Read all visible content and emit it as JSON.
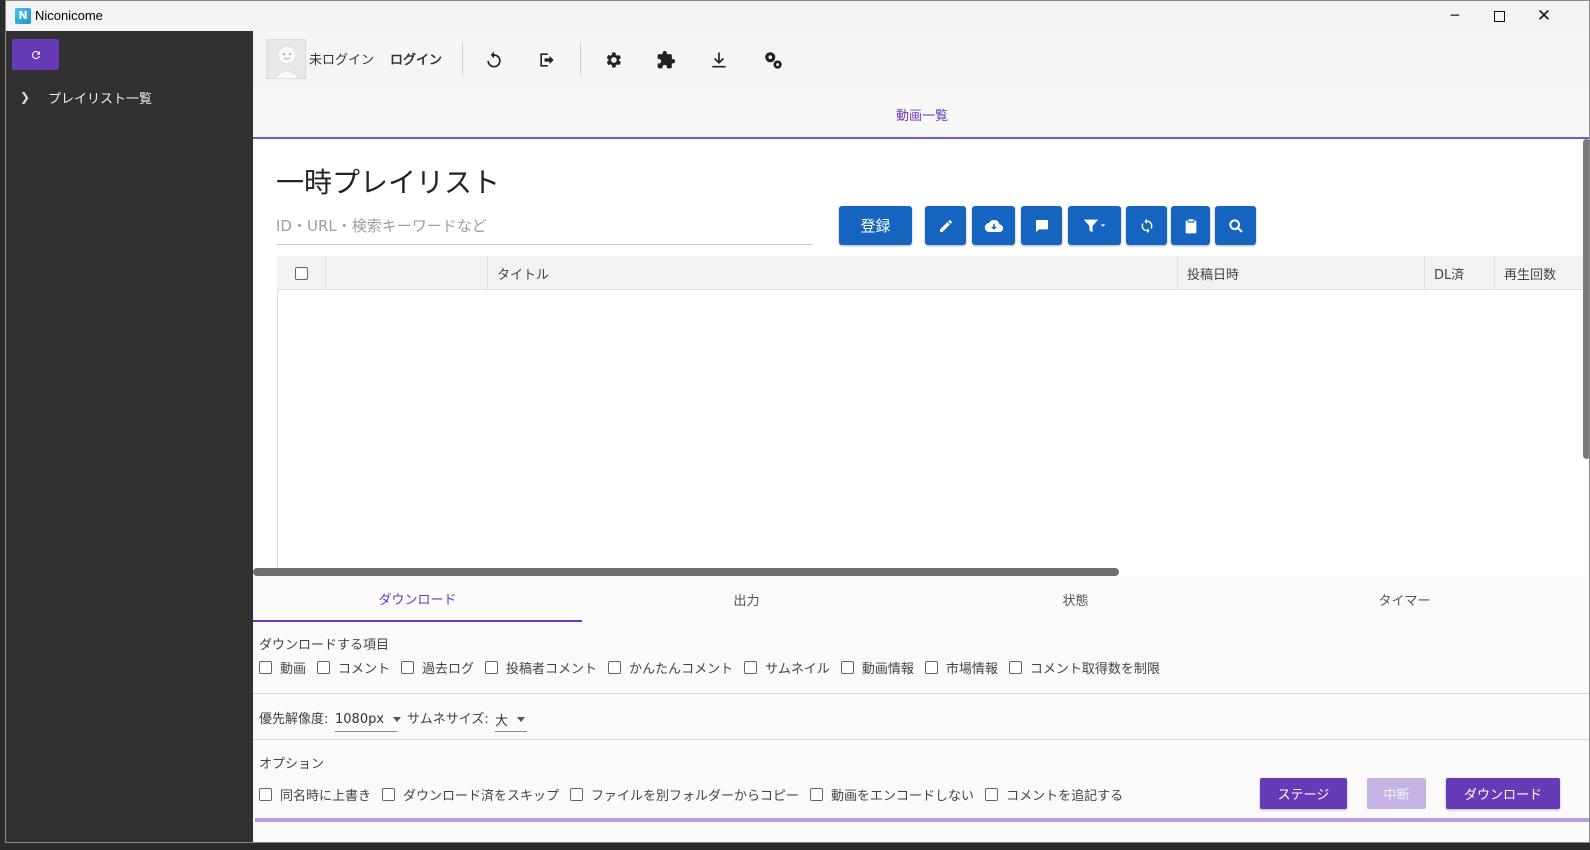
{
  "window": {
    "title": "Niconicome",
    "icon_letter": "N"
  },
  "sidebar": {
    "playlist_label": "プレイリスト一覧"
  },
  "toolbar": {
    "login_status": "未ログイン",
    "login_button": "ログイン"
  },
  "main_tab": "動画一覧",
  "playlist": {
    "title": "一時プレイリスト",
    "search_placeholder": "ID・URL・検索キーワードなど",
    "register_button": "登録"
  },
  "table": {
    "columns": [
      "タイトル",
      "投稿日時",
      "DL済",
      "再生回数"
    ]
  },
  "bottom_tabs": [
    "ダウンロード",
    "出力",
    "状態",
    "タイマー"
  ],
  "download": {
    "items_label": "ダウンロードする項目",
    "items": [
      "動画",
      "コメント",
      "過去ログ",
      "投稿者コメント",
      "かんたんコメント",
      "サムネイル",
      "動画情報",
      "市場情報",
      "コメント取得数を制限"
    ],
    "resolution_label": "優先解像度:",
    "resolution_value": "1080px",
    "thumb_label": "サムネサイズ:",
    "thumb_value": "大",
    "options_label": "オプション",
    "options": [
      "同名時に上書き",
      "ダウンロード済をスキップ",
      "ファイルを別フォルダーからコピー",
      "動画をエンコードしない",
      "コメントを追記する"
    ],
    "stage_button": "ステージ",
    "abort_button": "中断",
    "download_button": "ダウンロード"
  },
  "colors": {
    "accent": "#673ab7",
    "primary_blue": "#1565c0",
    "sidebar_bg": "#313131"
  }
}
